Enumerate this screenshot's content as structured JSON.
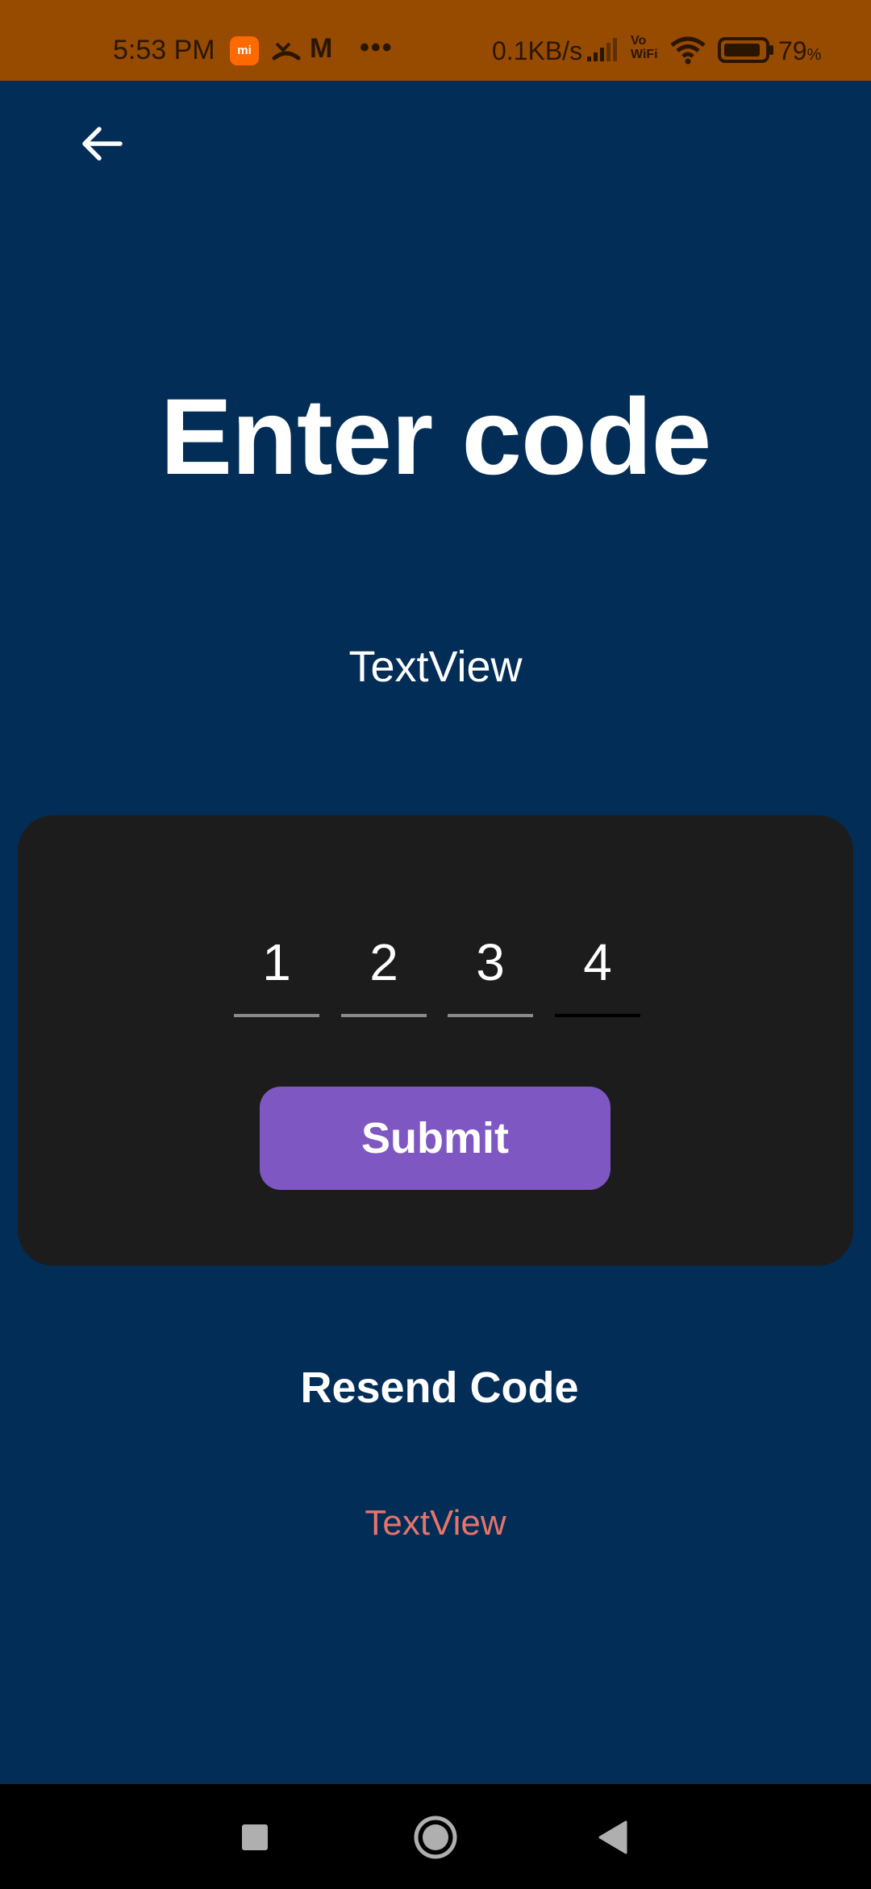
{
  "status_bar": {
    "time": "5:53 PM",
    "mi_badge": "mi",
    "carrier_letter": "M",
    "more": "•••",
    "net_speed": "0.1KB/s",
    "vowifi_top": "Vo",
    "vowifi_bottom": "WiFi",
    "battery_number": "79",
    "battery_symbol": "%",
    "icons": [
      "mi-icon",
      "missed-call-icon",
      "carrier-icon",
      "signal-icon",
      "wifi-icon",
      "battery-icon"
    ]
  },
  "screen": {
    "title": "Enter code",
    "subtitle": "TextView",
    "otp_digits": [
      "1",
      "2",
      "3",
      "4"
    ],
    "submit_label": "Submit",
    "resend_label": "Resend Code",
    "timer_text": "TextView"
  },
  "colors": {
    "background": "#022D57",
    "status_bar": "#964B00",
    "card": "#1C1C1C",
    "button": "#7E57C2",
    "timer_text": "#E8736B"
  },
  "nav": {
    "icons": [
      "recents-square-icon",
      "home-circle-icon",
      "back-triangle-icon"
    ]
  }
}
